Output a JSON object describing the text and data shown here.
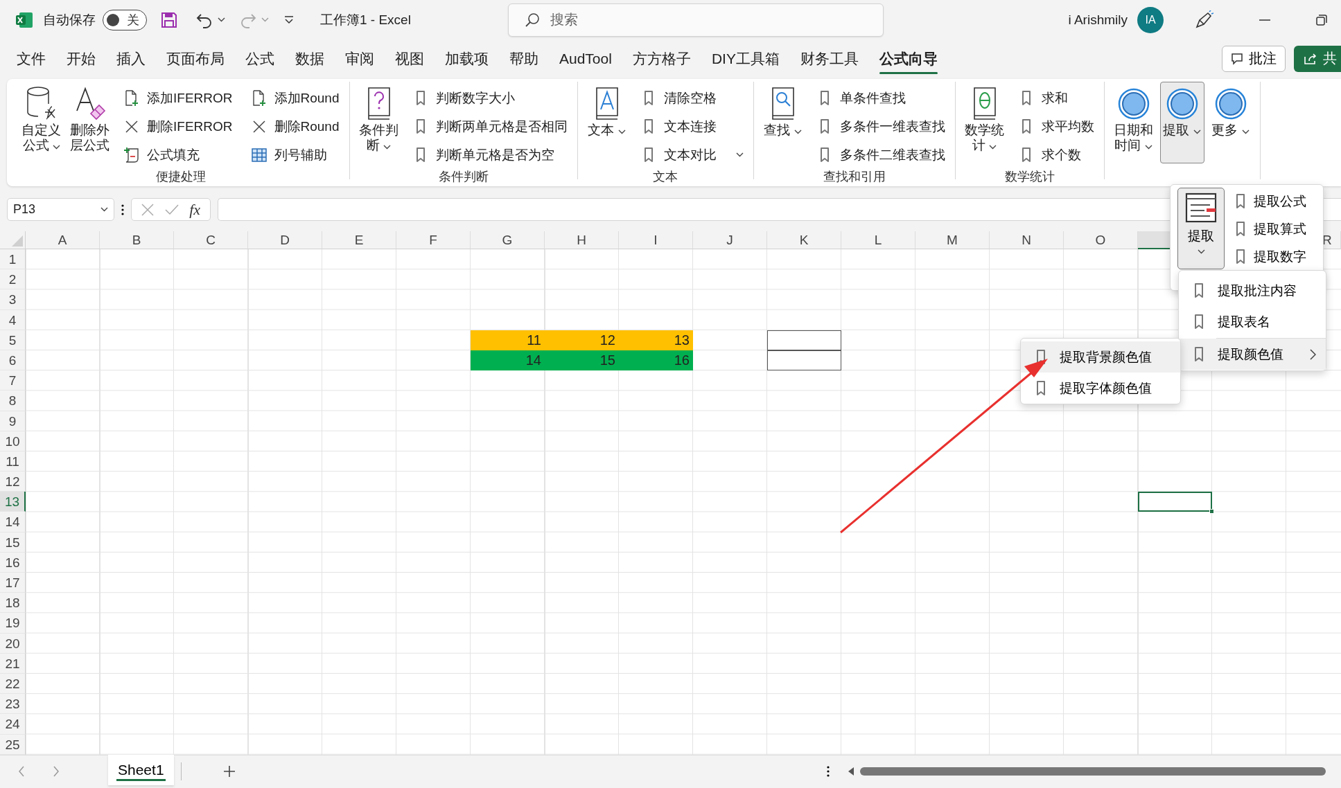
{
  "title_bar": {
    "autosave_label": "自动保存",
    "autosave": {
      "on": false,
      "label": "关"
    },
    "title": "工作簿1  -  Excel",
    "search": {
      "placeholder": "搜索"
    },
    "user_name": "i Arishmily",
    "avatar_initials": "IA"
  },
  "tabs": [
    {
      "label": "文件",
      "selected": false
    },
    {
      "label": "开始",
      "selected": false
    },
    {
      "label": "插入",
      "selected": false
    },
    {
      "label": "页面布局",
      "selected": false
    },
    {
      "label": "公式",
      "selected": false
    },
    {
      "label": "数据",
      "selected": false
    },
    {
      "label": "审阅",
      "selected": false
    },
    {
      "label": "视图",
      "selected": false
    },
    {
      "label": "加载项",
      "selected": false
    },
    {
      "label": "帮助",
      "selected": false
    },
    {
      "label": "AudTool",
      "selected": false
    },
    {
      "label": "方方格子",
      "selected": false
    },
    {
      "label": "DIY工具箱",
      "selected": false
    },
    {
      "label": "财务工具",
      "selected": false
    },
    {
      "label": "公式向导",
      "selected": true
    }
  ],
  "tab_actions": {
    "comments": "批注",
    "share": "共"
  },
  "ribbon": {
    "groups": [
      {
        "label": "便捷处理",
        "large": [
          {
            "label": "自定义公式",
            "has_menu": true,
            "pressed": false
          },
          {
            "label": "删除外层公式",
            "pressed": false
          }
        ],
        "columns": [
          [
            {
              "label": "添加IFERROR"
            },
            {
              "label": "删除IFERROR"
            },
            {
              "label": "公式填充"
            }
          ],
          [
            {
              "label": "添加Round"
            },
            {
              "label": "删除Round"
            },
            {
              "label": "列号辅助"
            }
          ]
        ]
      },
      {
        "label": "条件判断",
        "large": [
          {
            "label": "条件判断",
            "has_menu": true,
            "pressed": false
          }
        ],
        "columns": [
          [
            {
              "label": "判断数字大小"
            },
            {
              "label": "判断两单元格是否相同"
            },
            {
              "label": "判断单元格是否为空"
            }
          ]
        ]
      },
      {
        "label": "文本",
        "large": [
          {
            "label": "文本",
            "has_menu": true,
            "pressed": false
          }
        ],
        "columns": [
          [
            {
              "label": "清除空格"
            },
            {
              "label": "文本连接"
            },
            {
              "label": "文本对比",
              "has_menu": true
            }
          ]
        ]
      },
      {
        "label": "查找和引用",
        "large": [
          {
            "label": "查找",
            "has_menu": true,
            "pressed": false
          }
        ],
        "columns": [
          [
            {
              "label": "单条件查找"
            },
            {
              "label": "多条件一维表查找"
            },
            {
              "label": "多条件二维表查找"
            }
          ]
        ]
      },
      {
        "label": "数学统计",
        "large": [
          {
            "label": "数学统计",
            "has_menu": true,
            "pressed": false
          }
        ],
        "columns": [
          [
            {
              "label": "求和"
            },
            {
              "label": "求平均数"
            },
            {
              "label": "求个数"
            }
          ]
        ]
      },
      {
        "large": [
          {
            "label": "日期和时间",
            "has_menu": true,
            "pressed": false
          },
          {
            "label": "提取",
            "has_menu": true,
            "pressed": true
          },
          {
            "label": "更多",
            "has_menu": true,
            "pressed": false
          }
        ]
      }
    ]
  },
  "formula_bar": {
    "name_box": "P13",
    "function_label": "fx"
  },
  "sheet": {
    "columns": [
      {
        "label": "A",
        "selected": false
      },
      {
        "label": "B",
        "selected": false
      },
      {
        "label": "C",
        "selected": false
      },
      {
        "label": "D",
        "selected": false
      },
      {
        "label": "E",
        "selected": false
      },
      {
        "label": "F",
        "selected": false
      },
      {
        "label": "G",
        "selected": false
      },
      {
        "label": "H",
        "selected": false
      },
      {
        "label": "I",
        "selected": false
      },
      {
        "label": "J",
        "selected": false
      },
      {
        "label": "K",
        "selected": false
      },
      {
        "label": "L",
        "selected": false
      },
      {
        "label": "M",
        "selected": false
      },
      {
        "label": "N",
        "selected": false
      },
      {
        "label": "O",
        "selected": false
      },
      {
        "selected": true
      },
      {},
      {
        "label": "R",
        "selected": false
      }
    ],
    "rows": [
      {
        "header": "1",
        "selected": false
      },
      {
        "header": "2",
        "selected": false
      },
      {
        "header": "3",
        "selected": false
      },
      {
        "header": "4",
        "selected": false
      },
      {
        "header": "5",
        "selected": false,
        "cells": [
          null,
          null,
          null,
          null,
          null,
          null,
          {
            "value": "11",
            "color": "#ffc000"
          },
          {
            "value": "12",
            "color": "#ffc000"
          },
          {
            "value": "13",
            "color": "#ffc000"
          },
          null,
          {
            "bordered": true
          }
        ]
      },
      {
        "header": "6",
        "selected": false,
        "cells": [
          null,
          null,
          null,
          null,
          null,
          null,
          {
            "value": "14",
            "color": "#00b050"
          },
          {
            "value": "15",
            "color": "#00b050"
          },
          {
            "value": "16",
            "color": "#00b050"
          },
          null,
          {
            "bordered": true
          }
        ]
      },
      {
        "header": "7",
        "selected": false
      },
      {
        "header": "8",
        "selected": false
      },
      {
        "header": "9",
        "selected": false
      },
      {
        "header": "10",
        "selected": false
      },
      {
        "header": "11",
        "selected": false
      },
      {
        "header": "12",
        "selected": false
      },
      {
        "header": "13",
        "selected": true
      },
      {
        "header": "14",
        "selected": false
      },
      {
        "header": "15",
        "selected": false
      },
      {
        "header": "16",
        "selected": false
      },
      {
        "header": "17",
        "selected": false
      },
      {
        "header": "18",
        "selected": false
      },
      {
        "header": "19",
        "selected": false
      },
      {
        "header": "20",
        "selected": false
      },
      {
        "header": "21",
        "selected": false
      },
      {
        "header": "22",
        "selected": false
      },
      {
        "header": "23",
        "selected": false
      },
      {
        "header": "24",
        "selected": false
      },
      {
        "header": "25",
        "selected": false
      }
    ]
  },
  "sheet_tabs": [
    {
      "label": "Sheet1",
      "selected": true
    }
  ],
  "dropdown": {
    "button": {
      "label": "提取",
      "pressed": true
    },
    "items": [
      {
        "label": "提取公式"
      },
      {
        "label": "提取算式"
      },
      {
        "label": "提取数字"
      }
    ],
    "list": [
      {
        "label": "提取批注内容",
        "selected": false
      },
      {
        "label": "提取表名",
        "selected": false
      },
      {
        "label": "提取颜色值",
        "has_submenu": true,
        "selected": true
      }
    ],
    "submenu": [
      {
        "label": "提取背景颜色值",
        "selected": true
      },
      {
        "label": "提取字体颜色值",
        "selected": false
      }
    ]
  }
}
